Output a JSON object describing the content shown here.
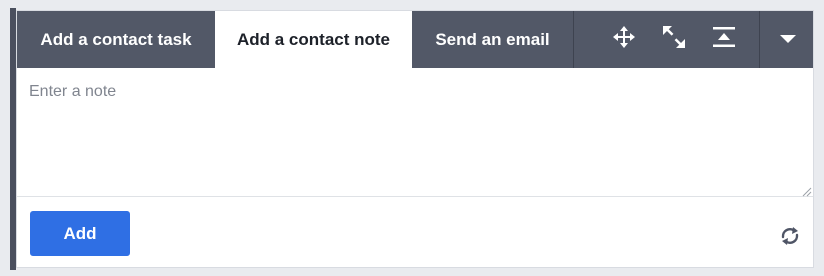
{
  "tabs": [
    {
      "label": "Add a contact task",
      "active": false
    },
    {
      "label": "Add a contact note",
      "active": true
    },
    {
      "label": "Send an email",
      "active": false
    }
  ],
  "toolbar": {
    "icons": [
      "move-icon",
      "expand-icon",
      "collapse-icon",
      "caret-down-icon"
    ]
  },
  "note": {
    "placeholder": "Enter a note",
    "value": ""
  },
  "footer": {
    "add_label": "Add",
    "refresh_icon": "refresh-icon"
  },
  "colors": {
    "tabbar": "#525867",
    "active_tab": "#ffffff",
    "primary_button": "#2f6fe4",
    "rail": "#4a4f5e"
  }
}
